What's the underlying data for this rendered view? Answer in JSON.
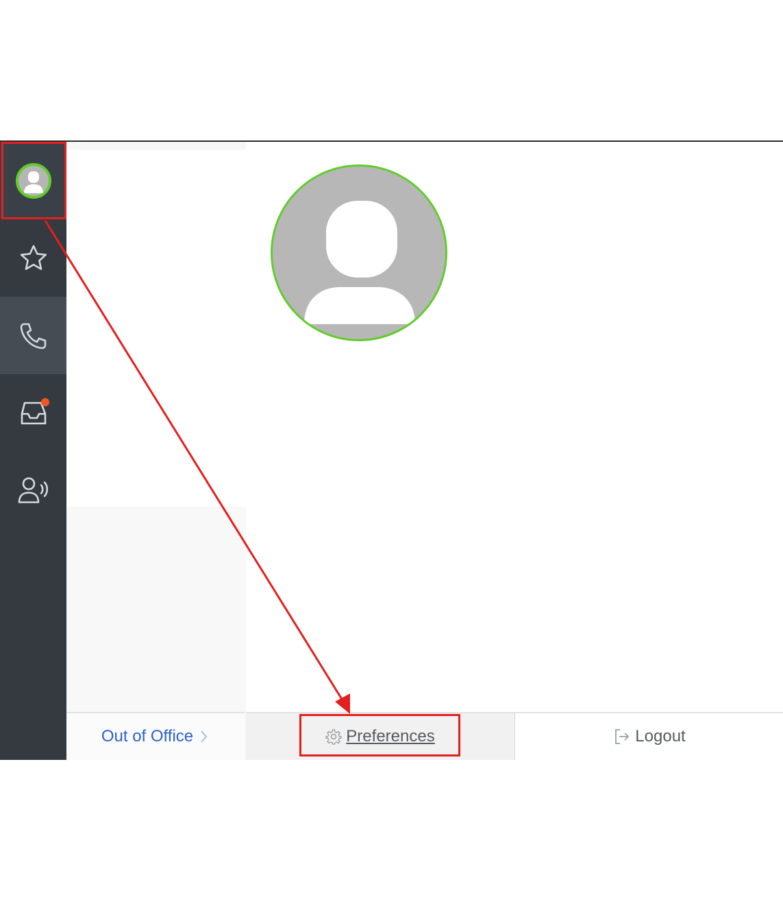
{
  "rail": {
    "items": [
      {
        "name": "profile",
        "icon": "user-avatar-icon"
      },
      {
        "name": "favorites",
        "icon": "star-icon"
      },
      {
        "name": "calls",
        "icon": "phone-icon"
      },
      {
        "name": "inbox",
        "icon": "inbox-icon",
        "has_notification": true
      },
      {
        "name": "contacts",
        "icon": "user-voice-icon"
      }
    ],
    "notification_color": "#f1561f"
  },
  "profile": {
    "status_color": "#62cc2c"
  },
  "footer": {
    "out_of_office_label": "Out of Office",
    "preferences_label": "Preferences",
    "logout_label": "Logout"
  },
  "annotations": {
    "highlight_color": "#e41f1f"
  }
}
